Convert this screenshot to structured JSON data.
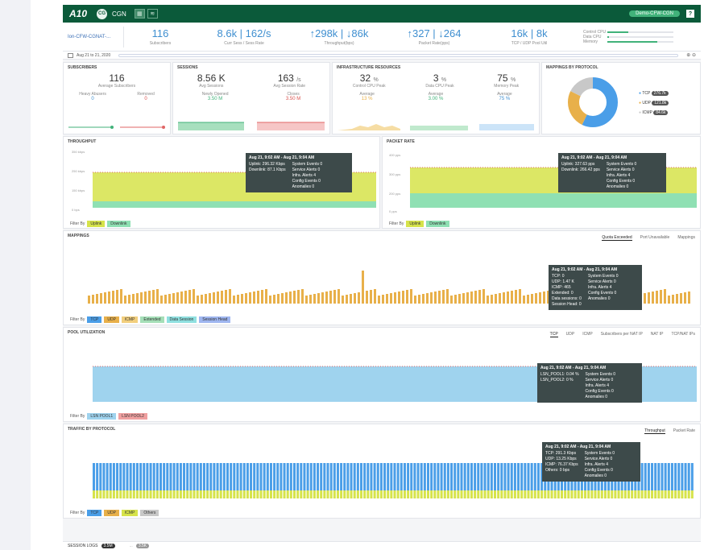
{
  "topbar": {
    "logo": "A10",
    "badge": "CG",
    "app": "CGN",
    "device": "Demo-CFW-CGN",
    "help": "?"
  },
  "stats": {
    "device_select": "Ion-CFW-CGNAT-...",
    "subscribers": "116",
    "subscribers_label": "Subscribers",
    "curr_rate": "8.6k | 162/s",
    "curr_rate_label": "Curr Sess / Sess Rate",
    "throughput": "↑298k | ↓86k",
    "throughput_label": "Throughput(bps)",
    "packet_rate": "↑327 | ↓264",
    "packet_rate_label": "Packet Rate(pps)",
    "tcp_udp": "16k | 8k",
    "tcp_udp_label": "TCP / UDP Pool Util",
    "mini": [
      {
        "label": "Control CPU",
        "pct": 0.32
      },
      {
        "label": "Data CPU",
        "pct": 0.03
      },
      {
        "label": "Memory",
        "pct": 0.75
      }
    ]
  },
  "date": {
    "range": "Aug 21 to 21, 2020",
    "zoom": "⊕ ⊖"
  },
  "subscribers": {
    "title": "Subscribers",
    "value": "116",
    "label": "Average Subscribers",
    "heavy_label": "Heavy Abusers",
    "heavy": "0",
    "removed_label": "Removed",
    "removed": "0"
  },
  "sessions": {
    "title": "Sessions",
    "avg": "8.56 K",
    "avg_label": "Avg Sessions",
    "rate": "163",
    "rate_unit": "/s",
    "rate_label": "Avg Session Rate",
    "opened_label": "Newly Opened",
    "opened": "3.50 M",
    "closes_label": "Closes",
    "closes": "3.50 M"
  },
  "infra": {
    "title": "Infrastructure Resources",
    "cpu": "32",
    "cpu_label": "Control CPU Peak",
    "dcpu": "3",
    "dcpu_label": "Data CPU Peak",
    "mem": "75",
    "mem_label": "Memory Peak",
    "avg_label": "Average",
    "cpu_avg": "13 %",
    "dcpu_avg": "3.00 %",
    "mem_avg": "75 %"
  },
  "mappings_protocol": {
    "title": "Mappings by Protocol",
    "legend": [
      {
        "name": "TCP",
        "value": "276.7k",
        "color": "#4a9ee8"
      },
      {
        "name": "UDP",
        "value": "121.8k",
        "color": "#e8b04a"
      },
      {
        "name": "ICMP",
        "value": "84.6k",
        "color": "#c8c8c8"
      }
    ]
  },
  "throughput": {
    "title": "Throughput",
    "y": [
      "350 kbps",
      "250 kbps",
      "150 kbps",
      "0 bps"
    ],
    "filter": "Filter By",
    "uplink": "Uplink",
    "downlink": "Downlink",
    "tooltip": {
      "head": "Aug 21, 9:02 AM - Aug 21, 9:04 AM",
      "lines": [
        "Uplink: 296.32 Kbps",
        "Downlink: 87.1 Kbps"
      ],
      "right": [
        "System Events  0",
        "Service Alerts  0",
        "Infra. Alerts  4",
        "Config Events  0",
        "Anomalies  0"
      ]
    }
  },
  "packet": {
    "title": "Packet Rate",
    "y": [
      "400 pps",
      "300 pps",
      "200 pps",
      "0 pps"
    ],
    "filter": "Filter By",
    "uplink": "Uplink",
    "downlink": "Downlink",
    "tooltip": {
      "head": "Aug 21, 9:02 AM - Aug 21, 9:04 AM",
      "lines": [
        "Uplink: 327.63 pps",
        "Downlink: 266.42 pps"
      ],
      "right": [
        "System Events  0",
        "Service Alerts  0",
        "Infra. Alerts  4",
        "Config Events  0",
        "Anomalies  0"
      ]
    }
  },
  "mappings": {
    "title": "Mappings",
    "tabs": [
      "Quota Exceeded",
      "Port Unavailable",
      "Mappings"
    ],
    "filter": "Filter By",
    "chips": [
      "TCP",
      "UDP",
      "ICMP",
      "Extended",
      "Data Session",
      "Session Head"
    ],
    "tooltip": {
      "head": "Aug 21, 9:02 AM - Aug 21, 9:04 AM",
      "lines": [
        "TCP: 0",
        "UDP: 1.47 K",
        "ICMP: 465",
        "Extended: 0",
        "Data sessions: 0",
        "Session Head: 0"
      ],
      "right": [
        "System Events  0",
        "Service Alerts  0",
        "Infra. Alerts  4",
        "Config Events  0",
        "Anomalies  0"
      ]
    }
  },
  "pool": {
    "title": "Pool Utilization",
    "tabs": [
      "TCP",
      "UDP",
      "ICMP",
      "Subscribers per NAT IP",
      "NAT IP",
      "TCP/NAT IPs"
    ],
    "filter": "Filter By",
    "chips": [
      "LSN POOL1",
      "LSN POOL2"
    ],
    "tooltip": {
      "head": "Aug 21, 9:02 AM - Aug 21, 9:04 AM",
      "lines": [
        "LSN_POOL1: 0.04 %",
        "LSN_POOL2: 0 %"
      ],
      "right": [
        "System Events  0",
        "Service Alerts  0",
        "Infra. Alerts  4",
        "Config Events  0",
        "Anomalies  0"
      ]
    }
  },
  "traffic": {
    "title": "Traffic by Protocol",
    "tabs": [
      "Throughput",
      "Packet Rate"
    ],
    "filter": "Filter By",
    "chips": [
      "TCP",
      "UDP",
      "ICMP",
      "Others"
    ],
    "tooltip": {
      "head": "Aug 21, 9:02 AM - Aug 21, 9:04 AM",
      "lines": [
        "TCP: 291.3 Kbps",
        "UDP: 13.25 Kbps",
        "ICMP: 76.37 Kbps",
        "Others: 0 bps"
      ],
      "right": [
        "System Events  0",
        "Service Alerts  0",
        "Infra. Alerts  4",
        "Config Events  0",
        "Anomalies  0"
      ]
    }
  },
  "bottom": {
    "label": "SESSION LOGS",
    "count": "3.5M",
    "label2": "...",
    "count2": "3.5K"
  }
}
